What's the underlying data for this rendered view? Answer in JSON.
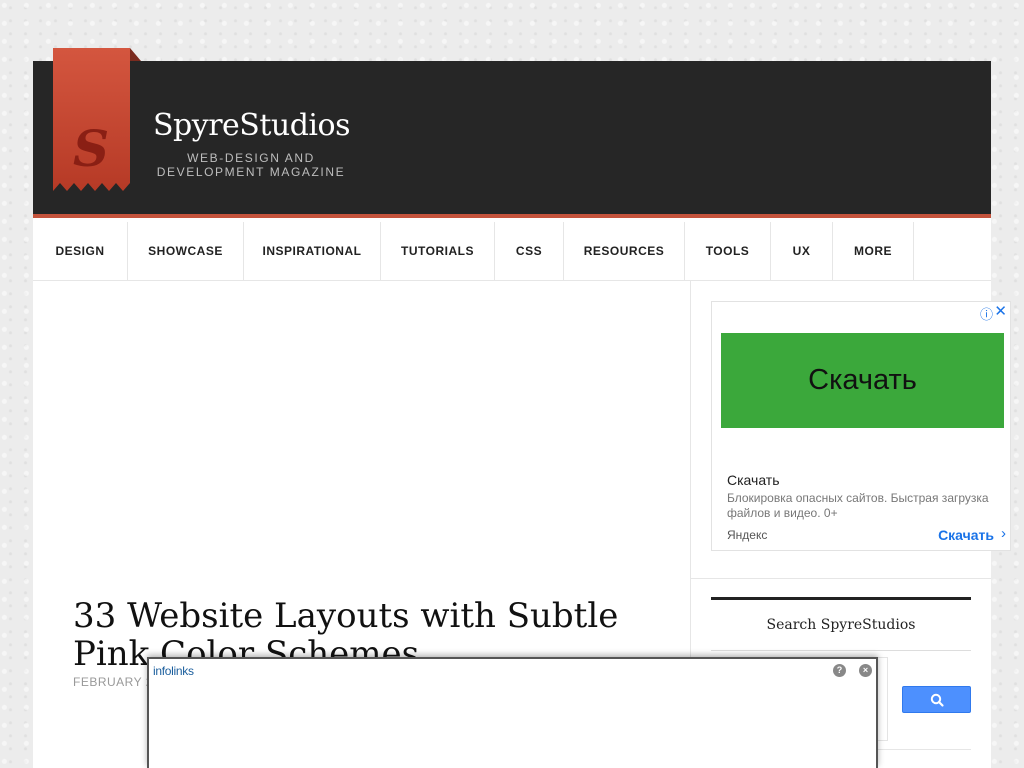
{
  "brand": {
    "logo_letter": "S",
    "title": "SpyreStudios",
    "tagline_line1": "WEB-DESIGN AND",
    "tagline_line2": "DEVELOPMENT MAGAZINE"
  },
  "nav": {
    "items": [
      {
        "label": "DESIGN"
      },
      {
        "label": "SHOWCASE"
      },
      {
        "label": "INSPIRATIONAL"
      },
      {
        "label": "TUTORIALS"
      },
      {
        "label": "CSS"
      },
      {
        "label": "RESOURCES"
      },
      {
        "label": "TOOLS"
      },
      {
        "label": "UX"
      },
      {
        "label": "MORE"
      }
    ]
  },
  "article": {
    "title": "33 Website Layouts with Subtle Pink Color Schemes",
    "date": "FEBRUARY 2"
  },
  "ad": {
    "info_icon": "ⓘ",
    "close_icon": "✕",
    "button_text": "Скачать",
    "headline": "Скачать",
    "description": "Блокировка опасных сайтов. Быстрая загрузка файлов и видео. 0+",
    "source": "Яндекс",
    "cta": "Скачать",
    "cta_chevron": "›"
  },
  "search": {
    "title": "Search SpyreStudios"
  },
  "popup": {
    "logo": "infolinks",
    "help": "?",
    "close": "×"
  },
  "colors": {
    "header_bg": "#262626",
    "accent": "#c4533c",
    "ad_green": "#3ba83b",
    "search_button": "#4d90fe"
  }
}
